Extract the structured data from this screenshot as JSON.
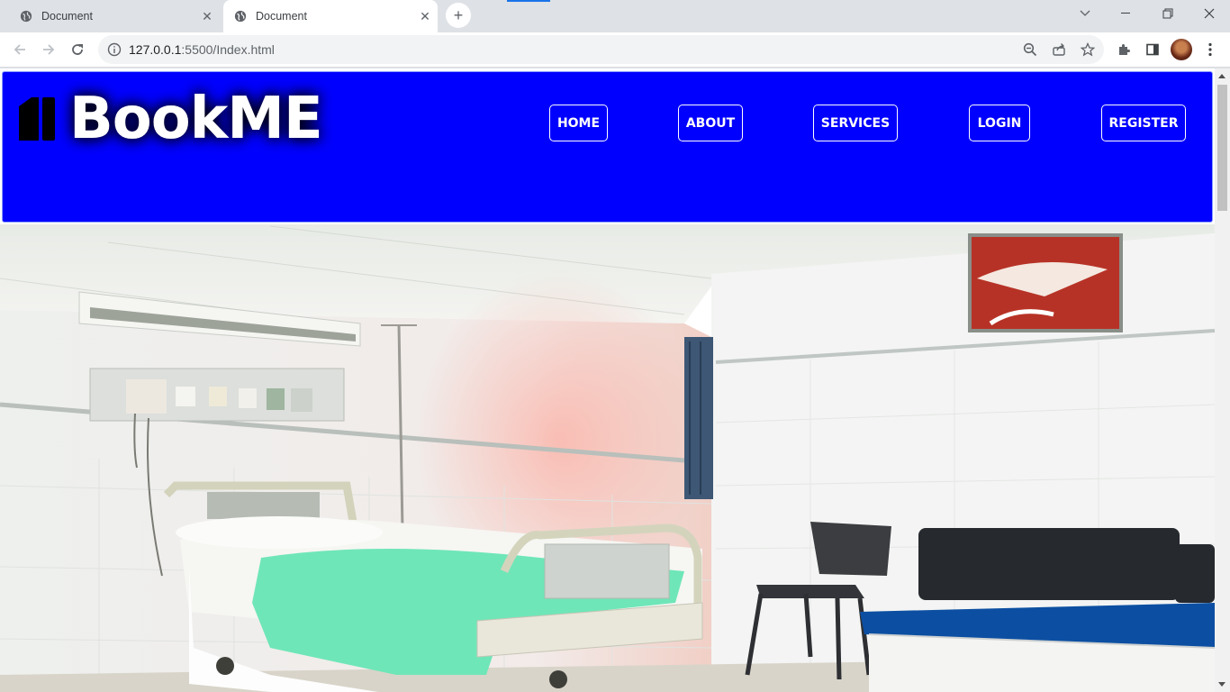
{
  "browser": {
    "tabs": [
      {
        "title": "Document",
        "active": false
      },
      {
        "title": "Document",
        "active": true
      }
    ],
    "new_tab_symbol": "+",
    "url_host": "127.0.0.1",
    "url_rest": ":5500/Index.html",
    "icons": {
      "tab_favicon": "globe-icon",
      "back": "back-arrow-icon",
      "forward": "forward-arrow-icon",
      "reload": "reload-icon",
      "site_info": "info-icon",
      "zoom": "zoom-out-icon",
      "share": "share-icon",
      "bookmark": "star-icon",
      "extensions": "puzzle-icon",
      "side_panel": "side-panel-icon",
      "menu": "kebab-menu-icon"
    }
  },
  "site": {
    "brand": "BookME",
    "brand_color": "#0000ff",
    "nav": [
      {
        "label": "HOME"
      },
      {
        "label": "ABOUT"
      },
      {
        "label": "SERVICES"
      },
      {
        "label": "LOGIN"
      },
      {
        "label": "REGISTER"
      }
    ],
    "hero_image": "hospital-room-photo"
  }
}
